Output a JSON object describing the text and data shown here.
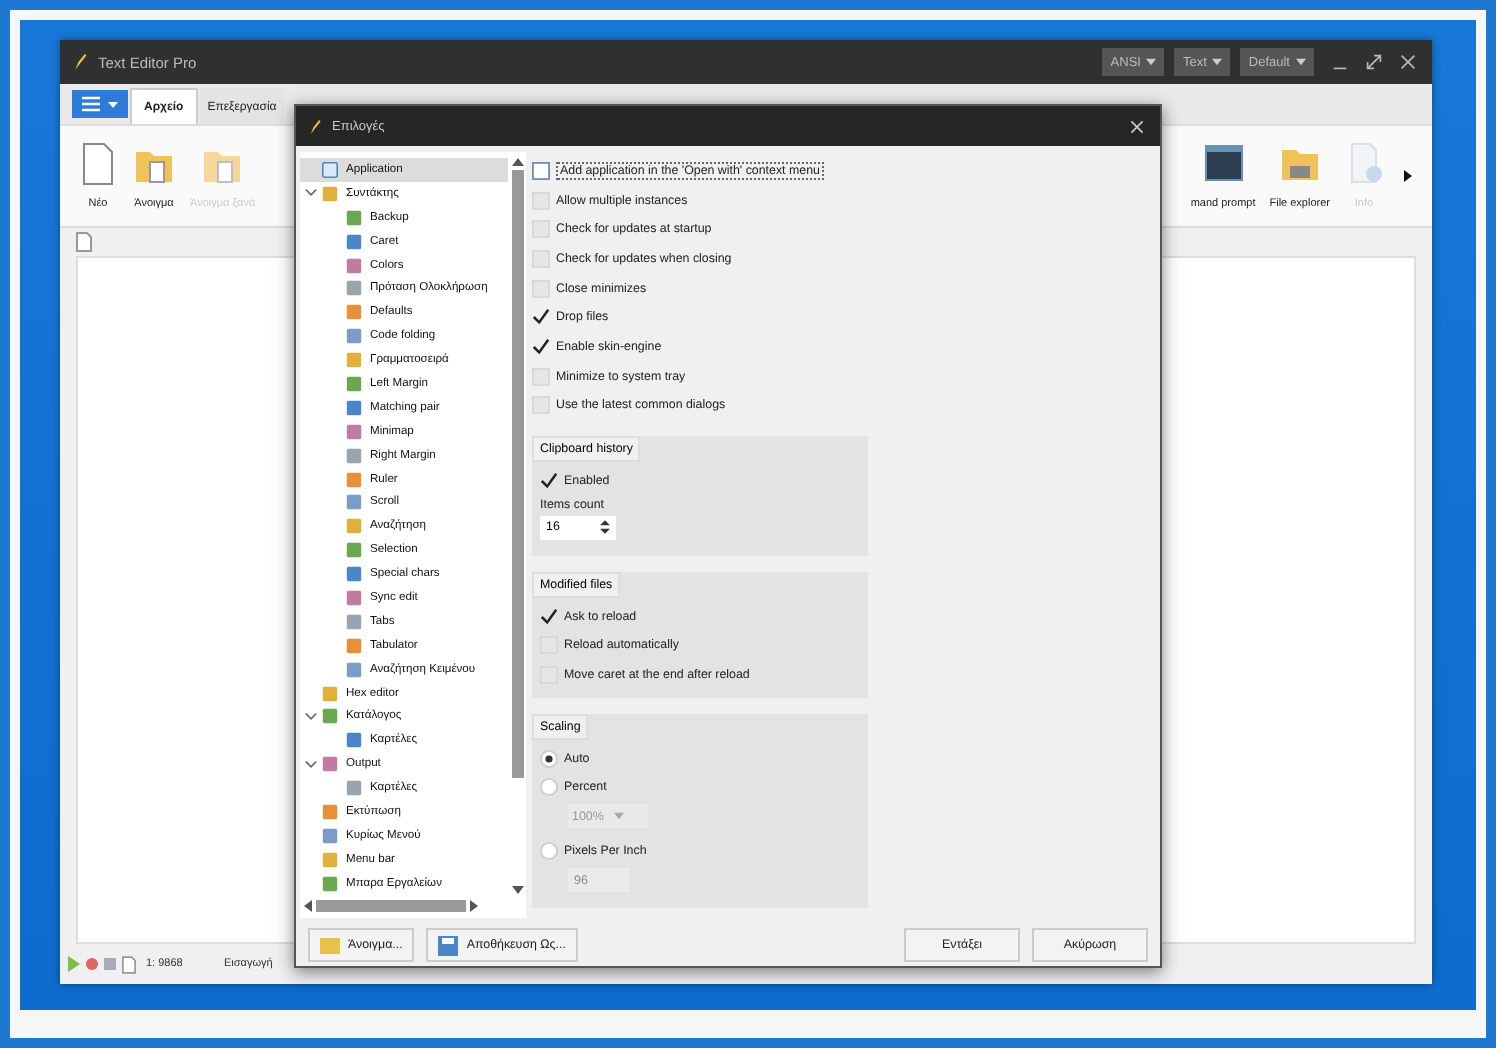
{
  "window": {
    "title": "Text Editor Pro",
    "dropdowns": [
      "ANSI",
      "Text",
      "Default"
    ]
  },
  "tabs": [
    {
      "label": "Αρχείο",
      "selected": true
    },
    {
      "label": "Επεξεργασία",
      "selected": false
    }
  ],
  "ribbon": {
    "left": [
      {
        "label": "Νέο",
        "disabled": false
      },
      {
        "label": "Άνοιγμα",
        "disabled": false
      },
      {
        "label": "Άνοιγμα ξανά",
        "disabled": true
      }
    ],
    "right": [
      {
        "label": "mand prompt",
        "disabled": false
      },
      {
        "label": "File explorer",
        "disabled": false
      },
      {
        "label": "Info",
        "disabled": true
      }
    ]
  },
  "status_bar": {
    "position": "1: 9868",
    "mode": "Εισαγωγή"
  },
  "dialog": {
    "title": "Επιλογές",
    "tree": [
      {
        "label": "Application",
        "selected": true
      },
      {
        "label": "Συντάκτης",
        "selected": false,
        "expanded": true,
        "children": [
          {
            "label": "Backup",
            "selected": false
          },
          {
            "label": "Caret",
            "selected": false
          },
          {
            "label": "Colors",
            "selected": false
          },
          {
            "label": "Πρόταση Ολοκλήρωση",
            "selected": false
          },
          {
            "label": "Defaults",
            "selected": false
          },
          {
            "label": "Code folding",
            "selected": false
          },
          {
            "label": "Γραμματοσειρά",
            "selected": false
          },
          {
            "label": "Left Margin",
            "selected": false
          },
          {
            "label": "Matching pair",
            "selected": false
          },
          {
            "label": "Minimap",
            "selected": false
          },
          {
            "label": "Right Margin",
            "selected": false
          },
          {
            "label": "Ruler",
            "selected": false
          },
          {
            "label": "Scroll",
            "selected": false
          },
          {
            "label": "Αναζήτηση",
            "selected": false
          },
          {
            "label": "Selection",
            "selected": false
          },
          {
            "label": "Special chars",
            "selected": false
          },
          {
            "label": "Sync edit",
            "selected": false
          },
          {
            "label": "Tabs",
            "selected": false
          },
          {
            "label": "Tabulator",
            "selected": false
          },
          {
            "label": "Αναζήτηση Κειμένου",
            "selected": false
          }
        ]
      },
      {
        "label": "Hex editor",
        "selected": false
      },
      {
        "label": "Κατάλογος",
        "selected": false,
        "expanded": true,
        "children": [
          {
            "label": "Καρτέλες",
            "selected": false
          }
        ]
      },
      {
        "label": "Output",
        "selected": false,
        "expanded": true,
        "children": [
          {
            "label": "Καρτέλες",
            "selected": false
          }
        ]
      },
      {
        "label": "Εκτύπωση",
        "selected": false
      },
      {
        "label": "Κυρίως Μενού",
        "selected": false
      },
      {
        "label": "Menu bar",
        "selected": false
      },
      {
        "label": "Μπαρα Εργαλείων",
        "selected": false
      }
    ],
    "options": [
      {
        "label": "Add application in the 'Open with' context menu",
        "checked": false
      },
      {
        "label": "Allow multiple instances",
        "checked": false
      },
      {
        "label": "Check for updates at startup",
        "checked": false
      },
      {
        "label": "Check for updates when closing",
        "checked": false
      },
      {
        "label": "Close minimizes",
        "checked": false
      },
      {
        "label": "Drop files",
        "checked": true
      },
      {
        "label": "Enable skin-engine",
        "checked": true
      },
      {
        "label": "Minimize to system tray",
        "checked": false
      },
      {
        "label": "Use the latest common dialogs",
        "checked": false
      }
    ],
    "groups": [
      {
        "title": "Clipboard history",
        "items": [
          {
            "kind": "checkbox",
            "label": "Enabled",
            "checked": true
          },
          {
            "kind": "label",
            "label": "Items count"
          },
          {
            "kind": "spinner",
            "value": "16"
          }
        ]
      },
      {
        "title": "Modified files",
        "items": [
          {
            "kind": "checkbox",
            "label": "Ask to reload",
            "checked": true
          },
          {
            "kind": "checkbox",
            "label": "Reload automatically",
            "checked": false
          },
          {
            "kind": "checkbox",
            "label": "Move caret at the end after reload",
            "checked": false
          }
        ]
      },
      {
        "title": "Scaling",
        "items": [
          {
            "kind": "radio",
            "label": "Auto",
            "selected": true
          },
          {
            "kind": "radio",
            "label": "Percent",
            "selected": false
          },
          {
            "kind": "dropdown",
            "value": "100%",
            "disabled": true
          },
          {
            "kind": "radio",
            "label": "Pixels Per Inch",
            "selected": false
          },
          {
            "kind": "field",
            "value": "96",
            "disabled": true
          }
        ]
      }
    ],
    "left_buttons": [
      "Άνοιγμα...",
      "Αποθήκευση Ως..."
    ],
    "right_buttons": [
      "Εντάξει",
      "Ακύρωση"
    ]
  }
}
